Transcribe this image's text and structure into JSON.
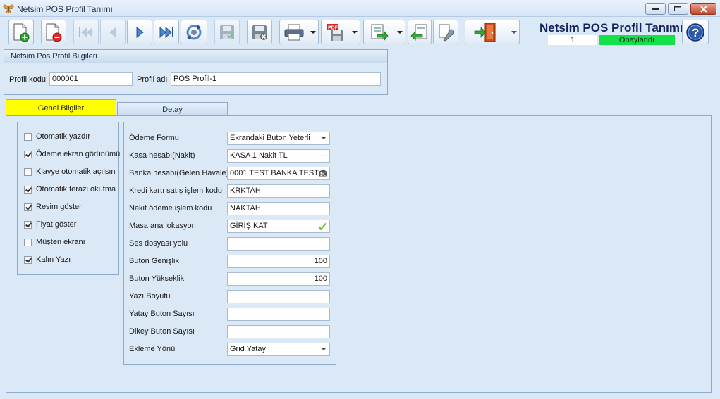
{
  "window": {
    "title": "Netsim POS Profil Tanımı"
  },
  "header": {
    "title": "Netsim POS Profil Tanımı",
    "record_number": "1",
    "status": "Onaylandı",
    "status_color": "#14e04a"
  },
  "toolbar": {
    "buttons": [
      {
        "name": "new-record",
        "icon": "new-document-icon"
      },
      {
        "name": "delete-record",
        "icon": "delete-document-icon"
      },
      {
        "name": "first-record",
        "icon": "first-icon"
      },
      {
        "name": "previous-record",
        "icon": "previous-icon"
      },
      {
        "name": "next-record",
        "icon": "next-icon"
      },
      {
        "name": "last-record",
        "icon": "last-icon"
      },
      {
        "name": "refresh",
        "icon": "refresh-icon"
      },
      {
        "name": "save",
        "icon": "save-icon"
      },
      {
        "name": "save-cancel",
        "icon": "save-cancel-icon"
      },
      {
        "name": "print",
        "icon": "printer-icon"
      },
      {
        "name": "pdf",
        "icon": "pdf-save-icon"
      },
      {
        "name": "export",
        "icon": "export-icon"
      },
      {
        "name": "import",
        "icon": "import-icon"
      },
      {
        "name": "settings",
        "icon": "wrench-icon"
      },
      {
        "name": "exit",
        "icon": "exit-door-icon"
      }
    ]
  },
  "profile": {
    "group_title": "Netsim Pos Profil Bilgileri",
    "code_label": "Profil kodu",
    "code_value": "000001",
    "name_label": "Profil adı",
    "name_value": "POS Profil-1"
  },
  "tabs": [
    {
      "label": "Genel Bilgiler",
      "active": true
    },
    {
      "label": "Detay",
      "active": false
    }
  ],
  "options": [
    {
      "label": "Otomatik yazdır",
      "checked": false
    },
    {
      "label": "Ödeme ekran görünümü",
      "checked": true
    },
    {
      "label": "Klavye otomatik açılsın",
      "checked": false
    },
    {
      "label": "Otomatik terazi okutma",
      "checked": true
    },
    {
      "label": "Resim göster",
      "checked": true
    },
    {
      "label": "Fiyat göster",
      "checked": true
    },
    {
      "label": "Müşteri ekranı",
      "checked": false
    },
    {
      "label": "Kalın Yazı",
      "checked": true
    }
  ],
  "form": [
    {
      "label": "Ödeme Formu",
      "value": "Ekrandaki Buton Yeterli",
      "kind": "dropdown"
    },
    {
      "label": "Kasa hesabı(Nakit)",
      "value": "KASA 1 Nakit TL",
      "kind": "lookup"
    },
    {
      "label": "Banka hesabı(Gelen Havale)",
      "value": "0001 TEST BANKA TEST Ş",
      "kind": "bank"
    },
    {
      "label": "Kredi kartı satış işlem kodu",
      "value": "KRKTAH",
      "kind": "text"
    },
    {
      "label": "Nakit ödeme işlem kodu",
      "value": "NAKTAH",
      "kind": "text"
    },
    {
      "label": "Masa ana lokasyon",
      "value": "GİRİŞ KAT",
      "kind": "check"
    },
    {
      "label": "Ses dosyası yolu",
      "value": "",
      "kind": "text"
    },
    {
      "label": "Buton Genişlik",
      "value": "100",
      "kind": "number"
    },
    {
      "label": "Buton Yükseklik",
      "value": "100",
      "kind": "number"
    },
    {
      "label": "Yazı Boyutu",
      "value": "",
      "kind": "text"
    },
    {
      "label": "Yatay Buton Sayısı",
      "value": "",
      "kind": "text"
    },
    {
      "label": "Dikey Buton Sayısı",
      "value": "",
      "kind": "text"
    },
    {
      "label": "Ekleme Yönü",
      "value": "Grid Yatay",
      "kind": "dropdown"
    }
  ],
  "lookup_suffix": "···"
}
